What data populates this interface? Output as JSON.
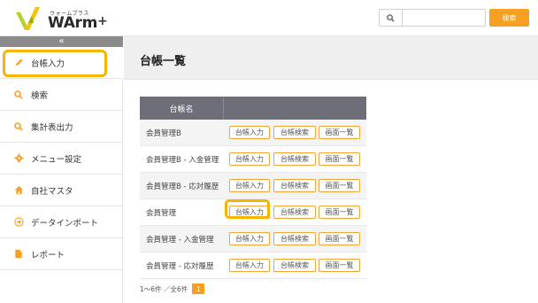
{
  "header": {
    "logo_kana": "ウォームプラス",
    "logo_text": "WArm",
    "logo_plus": "+",
    "search_placeholder": "",
    "search_button": "検索"
  },
  "sidebar": {
    "collapse_glyph": "«",
    "items": [
      {
        "label": "台帳入力",
        "icon": "pencil-icon"
      },
      {
        "label": "検索",
        "icon": "search-icon"
      },
      {
        "label": "集計表出力",
        "icon": "search-icon"
      },
      {
        "label": "メニュー設定",
        "icon": "gear-icon"
      },
      {
        "label": "自社マスタ",
        "icon": "home-icon"
      },
      {
        "label": "データインポート",
        "icon": "import-icon"
      },
      {
        "label": "レポート",
        "icon": "document-icon"
      }
    ]
  },
  "main": {
    "title": "台帳一覧",
    "table": {
      "header_name": "台帳名",
      "rows": [
        {
          "name": "会員管理B",
          "btn1": "台帳入力",
          "btn2": "台帳検索",
          "btn3": "画面一覧"
        },
        {
          "name": "会員管理B - 入金管理",
          "btn1": "台帳入力",
          "btn2": "台帳検索",
          "btn3": "画面一覧"
        },
        {
          "name": "会員管理B - 応対履歴",
          "btn1": "台帳入力",
          "btn2": "台帳検索",
          "btn3": "画面一覧"
        },
        {
          "name": "会員管理",
          "btn1": "台帳入力",
          "btn2": "台帳検索",
          "btn3": "画面一覧"
        },
        {
          "name": "会員管理 - 入金管理",
          "btn1": "台帳入力",
          "btn2": "台帳検索",
          "btn3": "画面一覧"
        },
        {
          "name": "会員管理 - 応対履歴",
          "btn1": "台帳入力",
          "btn2": "台帳検索",
          "btn3": "画面一覧"
        }
      ]
    },
    "pager": {
      "summary": "1～6件 ／全6件",
      "current_page": "1"
    }
  },
  "colors": {
    "accent": "#f5a023",
    "highlight": "#f7b500",
    "table_header": "#6e6e78"
  }
}
